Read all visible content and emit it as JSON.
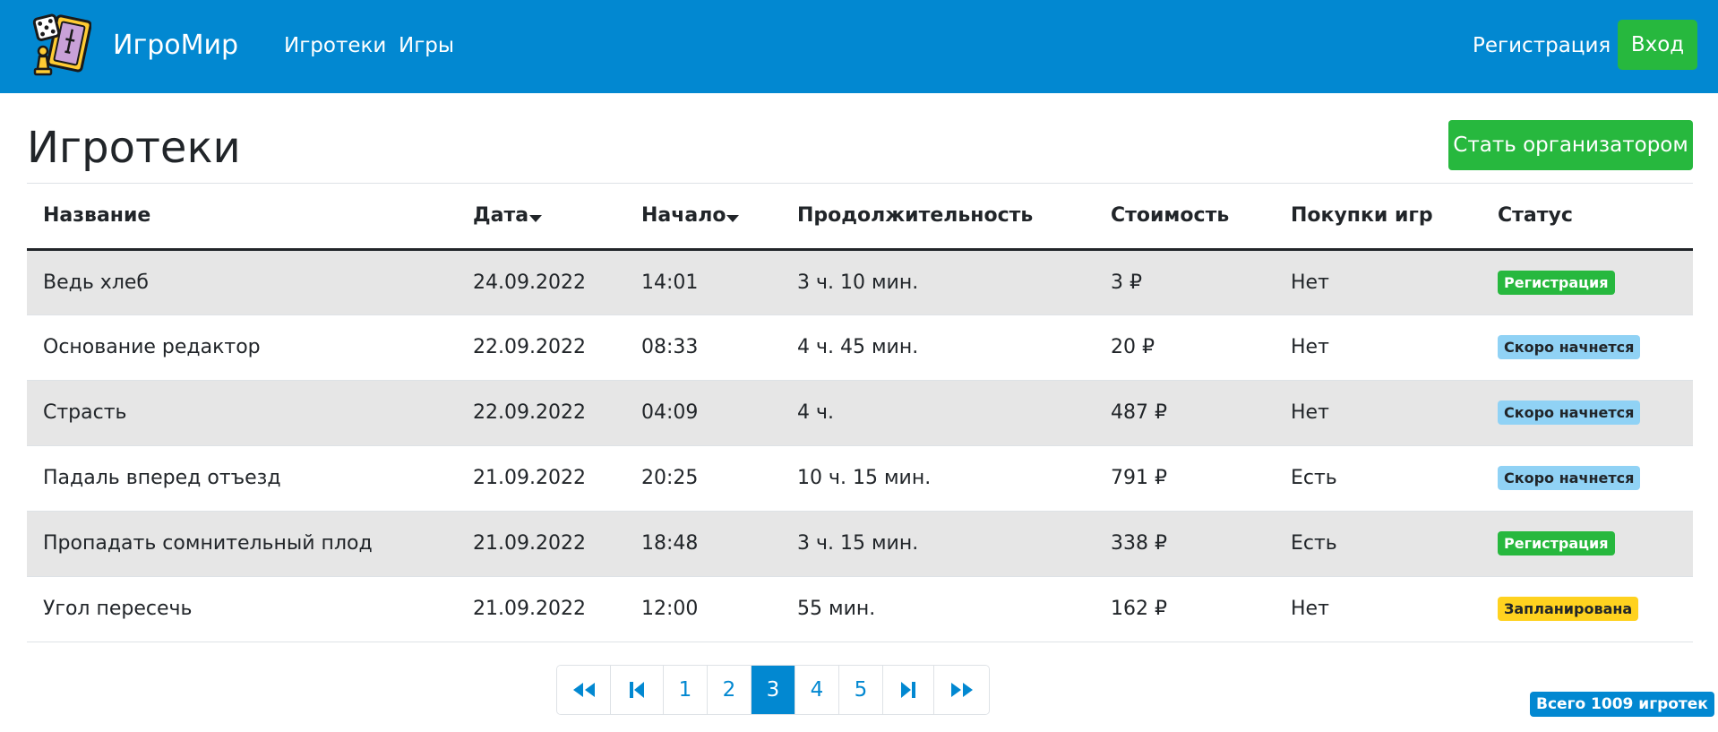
{
  "header": {
    "brand": "ИгроМир",
    "nav": [
      "Игротеки",
      "Игры"
    ],
    "register_label": "Регистрация",
    "login_label": "Вход",
    "logo_icon": "dice-and-card-logo-icon"
  },
  "page": {
    "title": "Игротеки",
    "organizer_button": "Стать организатором"
  },
  "table": {
    "columns": [
      "Название",
      "Дата",
      "Начало",
      "Продолжительность",
      "Стоимость",
      "Покупки игр",
      "Статус"
    ],
    "sortable_columns": [
      "Дата",
      "Начало"
    ],
    "rows": [
      {
        "name": "Ведь хлеб",
        "date": "24.09.2022",
        "start": "14:01",
        "duration": "3 ч. 10 мин.",
        "cost": "3 ₽",
        "purchases": "Нет",
        "status": "Регистрация",
        "status_type": "registration"
      },
      {
        "name": "Основание редактор",
        "date": "22.09.2022",
        "start": "08:33",
        "duration": "4 ч. 45 мин.",
        "cost": "20 ₽",
        "purchases": "Нет",
        "status": "Скоро начнется",
        "status_type": "soon"
      },
      {
        "name": "Страсть",
        "date": "22.09.2022",
        "start": "04:09",
        "duration": "4 ч.",
        "cost": "487 ₽",
        "purchases": "Нет",
        "status": "Скоро начнется",
        "status_type": "soon"
      },
      {
        "name": "Падаль вперед отъезд",
        "date": "21.09.2022",
        "start": "20:25",
        "duration": "10 ч. 15 мин.",
        "cost": "791 ₽",
        "purchases": "Есть",
        "status": "Скоро начнется",
        "status_type": "soon"
      },
      {
        "name": "Пропадать сомнительный плод",
        "date": "21.09.2022",
        "start": "18:48",
        "duration": "3 ч. 15 мин.",
        "cost": "338 ₽",
        "purchases": "Есть",
        "status": "Регистрация",
        "status_type": "registration"
      },
      {
        "name": "Угол пересечь",
        "date": "21.09.2022",
        "start": "12:00",
        "duration": "55 мин.",
        "cost": "162 ₽",
        "purchases": "Нет",
        "status": "Запланирована",
        "status_type": "planned"
      }
    ]
  },
  "pagination": {
    "pages": [
      "1",
      "2",
      "3",
      "4",
      "5"
    ],
    "current": "3",
    "icons": [
      "double-left-icon",
      "skip-back-icon",
      "skip-forward-icon",
      "double-right-icon"
    ]
  },
  "total": "Всего 1009 игротек",
  "colors": {
    "primary": "#0288d1",
    "success": "#27b83e",
    "info_light": "#90d2f5",
    "warning": "#ffd21f",
    "stripe": "#e6e6e6"
  }
}
